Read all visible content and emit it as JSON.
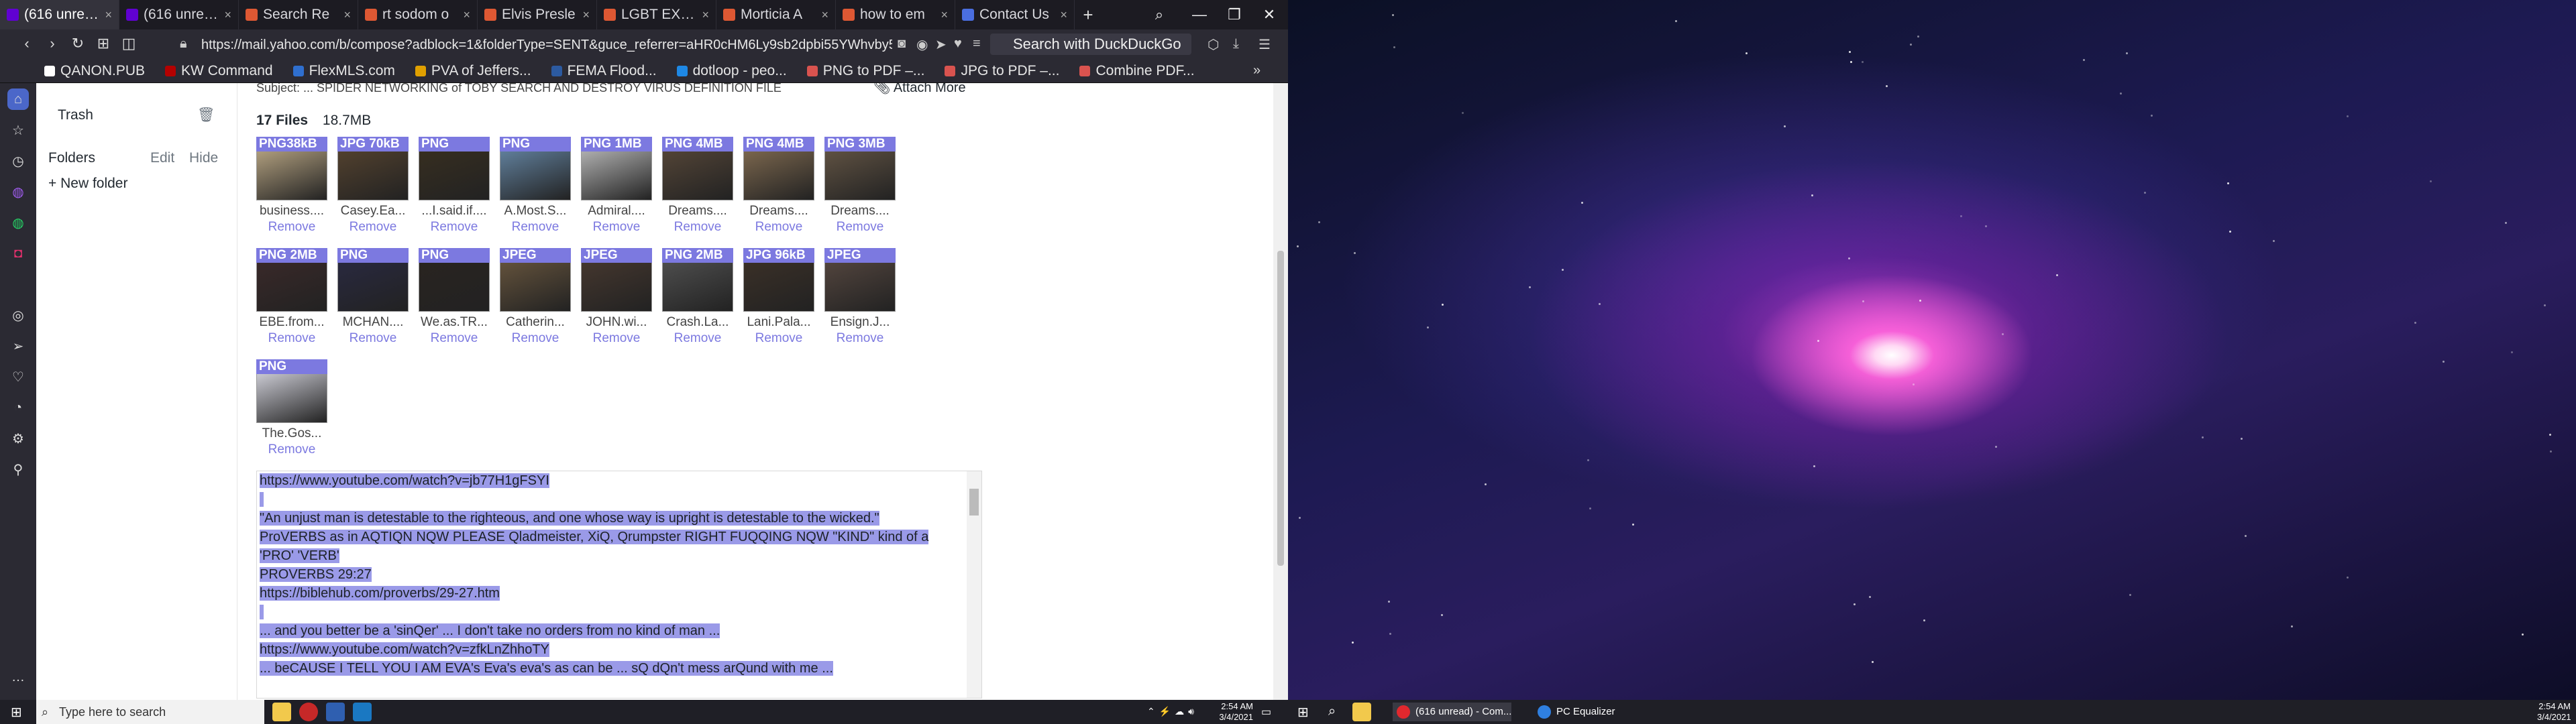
{
  "browser": {
    "tabs": [
      {
        "label": "(616 unread)",
        "color": "#6001d2",
        "active": true
      },
      {
        "label": "(616 unread)",
        "color": "#6001d2",
        "active": false
      },
      {
        "label": "Search Re",
        "color": "#de5833",
        "active": false
      },
      {
        "label": "rt sodom o",
        "color": "#de5833",
        "active": false
      },
      {
        "label": "Elvis Presle",
        "color": "#de5833",
        "active": false
      },
      {
        "label": "LGBT EXPO",
        "color": "#de5833",
        "active": false
      },
      {
        "label": "Morticia A",
        "color": "#de5833",
        "active": false
      },
      {
        "label": "how to em",
        "color": "#de5833",
        "active": false
      },
      {
        "label": "Contact Us",
        "color": "#4a6ee0",
        "active": false
      }
    ],
    "new_tab": "+",
    "url": "https://mail.yahoo.com/b/compose?adblock=1&folderType=SENT&guce_referrer=aHR0cHM6Ly9sb2dpbi55YWhvby5jb",
    "search_placeholder": "Search with DuckDuckGo",
    "window_controls": [
      "—",
      "❐",
      "✕"
    ]
  },
  "bookmarks": [
    {
      "label": "QANON.PUB",
      "color": "#ffffff"
    },
    {
      "label": "KW Command",
      "color": "#b40101"
    },
    {
      "label": "FlexMLS.com",
      "color": "#2f6fcf"
    },
    {
      "label": "PVA of Jeffers...",
      "color": "#e0a000"
    },
    {
      "label": "FEMA Flood...",
      "color": "#2c5aa0"
    },
    {
      "label": "dotloop - peo...",
      "color": "#1e88e5"
    },
    {
      "label": "PNG to PDF –...",
      "color": "#d9534f"
    },
    {
      "label": "JPG to PDF –...",
      "color": "#d9534f"
    },
    {
      "label": "Combine PDF...",
      "color": "#d9534f"
    }
  ],
  "mail_sidebar": {
    "trash": "Trash",
    "folders": "Folders",
    "edit": "Edit",
    "hide": "Hide",
    "new_folder": "+ New folder"
  },
  "compose": {
    "subject_fragment": "Subject: ... SPIDER NETWORKING of TOBY SEARCH AND DESTROY VIRUS DEFINITION FILE",
    "attach_more": "Attach More",
    "files_count": "17 Files",
    "files_size": "18.7MB",
    "remove_label": "Remove",
    "attachments": [
      {
        "badge": "PNG38kB",
        "name": "business....",
        "tint": "#c9b48e"
      },
      {
        "badge": "JPG 70kB",
        "name": "Casey.Ea...",
        "tint": "#5a4630"
      },
      {
        "badge": "PNG",
        "name": "...I.said.if....",
        "tint": "#3a3020"
      },
      {
        "badge": "PNG",
        "name": "A.Most.S...",
        "tint": "#6b8fb0"
      },
      {
        "badge": "PNG 1MB",
        "name": "Admiral....",
        "tint": "#c8c8c8"
      },
      {
        "badge": "PNG 4MB",
        "name": "Dreams....",
        "tint": "#5b4a3a"
      },
      {
        "badge": "PNG 4MB",
        "name": "Dreams....",
        "tint": "#8a7255"
      },
      {
        "badge": "PNG 3MB",
        "name": "Dreams....",
        "tint": "#6a5a48"
      },
      {
        "badge": "PNG 2MB",
        "name": "EBE.from...",
        "tint": "#3d2a2a"
      },
      {
        "badge": "PNG",
        "name": "MCHAN....",
        "tint": "#2a2a44"
      },
      {
        "badge": "PNG",
        "name": "We.as.TR...",
        "tint": "#2a2420"
      },
      {
        "badge": "JPEG",
        "name": "Catherin...",
        "tint": "#6e5a40"
      },
      {
        "badge": "JPEG",
        "name": "JOHN.wi...",
        "tint": "#4a3a30"
      },
      {
        "badge": "PNG 2MB",
        "name": "Crash.La...",
        "tint": "#555555"
      },
      {
        "badge": "JPG 96kB",
        "name": "Lani.Pala...",
        "tint": "#3e3228"
      },
      {
        "badge": "JPEG",
        "name": "Ensign.J...",
        "tint": "#5a4a42"
      },
      {
        "badge": "PNG",
        "name": "The.Gos...",
        "tint": "#e8e8f2"
      }
    ],
    "body_lines": [
      "https://www.youtube.com/watch?v=jb77H1gFSYI",
      "",
      "\"An unjust man is detestable to the righteous, and one whose way is upright is detestable to the wicked.\"",
      "ProVERBS as in AQTIQN NQW PLEASE Qladmeister, XiQ, Qrumpster RIGHT FUQQING NQW \"KIND\" kind of a",
      "'PRO' 'VERB'",
      "PROVERBS 29:27",
      "https://biblehub.com/proverbs/29-27.htm",
      "",
      "... and you better be a 'sinQer' ... I don't take no orders from no kind of man ...",
      "https://www.youtube.com/watch?v=zfkLnZhhoTY",
      "... beCAUSE I TELL YOU I AM EVA's Eva's eva's as can be ... sQ dQn't mess arQund with me ..."
    ]
  },
  "taskbar_left": {
    "search_placeholder": "Type here to search",
    "time": "2:54 AM",
    "date": "3/4/2021"
  },
  "taskbar_right": {
    "items": [
      {
        "label": "(616 unread) - Com...",
        "color": "#e0282e"
      },
      {
        "label": "PC Equalizer",
        "color": "#2f7fe0"
      }
    ],
    "time": "2:54 AM",
    "date": "3/4/2021"
  }
}
